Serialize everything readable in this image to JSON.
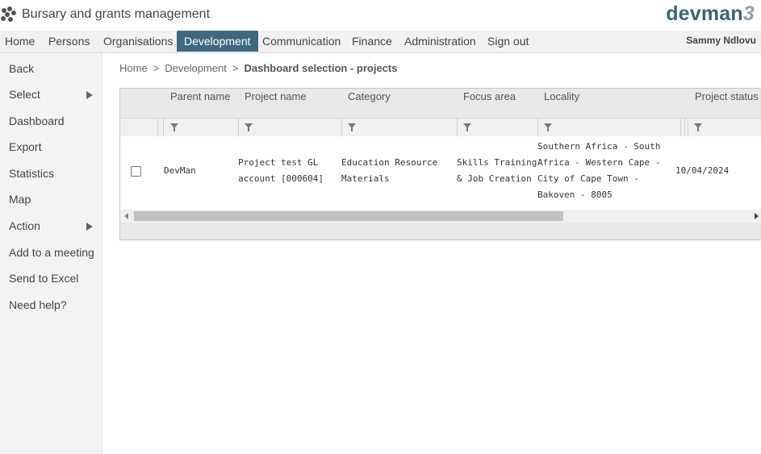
{
  "app": {
    "title": "Bursary and grants management",
    "brand_text": "devman",
    "brand_version": "3"
  },
  "nav": {
    "items": [
      {
        "label": "Home"
      },
      {
        "label": "Persons"
      },
      {
        "label": "Organisations"
      },
      {
        "label": "Development"
      },
      {
        "label": "Communication"
      },
      {
        "label": "Finance"
      },
      {
        "label": "Administration"
      },
      {
        "label": "Sign out"
      }
    ],
    "active": "Development",
    "user": "Sammy Ndlovu"
  },
  "sidebar": {
    "items": [
      {
        "label": "Back"
      },
      {
        "label": "Select"
      },
      {
        "label": "Dashboard"
      },
      {
        "label": "Export"
      },
      {
        "label": "Statistics"
      },
      {
        "label": "Map"
      },
      {
        "label": "Action"
      },
      {
        "label": "Add to a meeting"
      },
      {
        "label": "Send to Excel"
      },
      {
        "label": "Need help?"
      }
    ]
  },
  "breadcrumb": {
    "home": "Home",
    "section": "Development",
    "current": "Dashboard selection - projects",
    "separator": ">"
  },
  "grid": {
    "columns": [
      "Parent name",
      "Project name",
      "Category",
      "Focus area",
      "Locality",
      "Project status"
    ],
    "rows": [
      {
        "checked": false,
        "parent_name": "DevMan",
        "project_name_l1": "Project test GL",
        "project_name_l2": "account [000604]",
        "category_l1": "Education Resource",
        "category_l2": "Materials",
        "focus_l1": "Skills Training",
        "focus_l2": "& Job Creation",
        "locality_l1": "Southern Africa - South",
        "locality_l2": "Africa - Western Cape -",
        "locality_l3": "City of Cape Town -",
        "locality_l4": "Bakoven - 8005",
        "project_status": "10/04/2024"
      }
    ]
  },
  "colors": {
    "accent": "#3e6a80",
    "brand": "#3b6377"
  }
}
